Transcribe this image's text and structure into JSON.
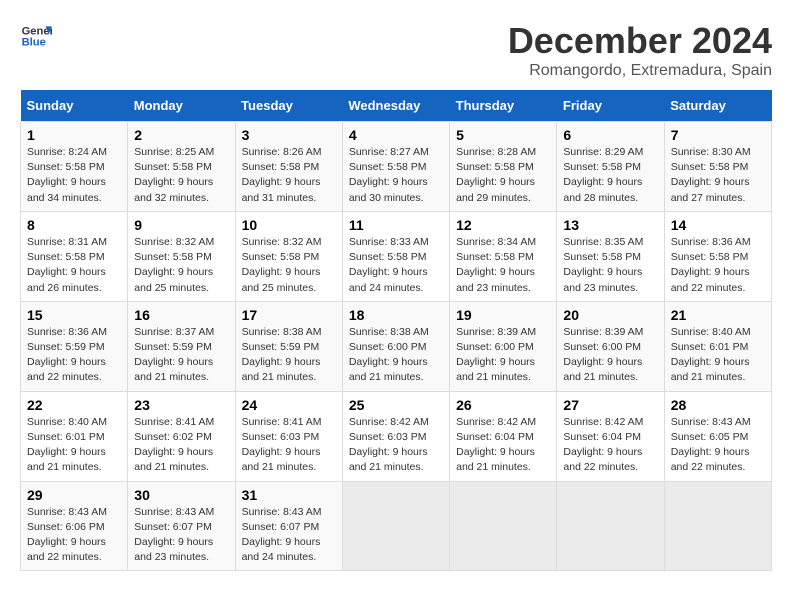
{
  "logo": {
    "line1": "General",
    "line2": "Blue"
  },
  "title": "December 2024",
  "subtitle": "Romangordo, Extremadura, Spain",
  "days_header": [
    "Sunday",
    "Monday",
    "Tuesday",
    "Wednesday",
    "Thursday",
    "Friday",
    "Saturday"
  ],
  "weeks": [
    [
      {
        "num": "1",
        "sunrise": "8:24 AM",
        "sunset": "5:58 PM",
        "daylight": "9 hours and 34 minutes."
      },
      {
        "num": "2",
        "sunrise": "8:25 AM",
        "sunset": "5:58 PM",
        "daylight": "9 hours and 32 minutes."
      },
      {
        "num": "3",
        "sunrise": "8:26 AM",
        "sunset": "5:58 PM",
        "daylight": "9 hours and 31 minutes."
      },
      {
        "num": "4",
        "sunrise": "8:27 AM",
        "sunset": "5:58 PM",
        "daylight": "9 hours and 30 minutes."
      },
      {
        "num": "5",
        "sunrise": "8:28 AM",
        "sunset": "5:58 PM",
        "daylight": "9 hours and 29 minutes."
      },
      {
        "num": "6",
        "sunrise": "8:29 AM",
        "sunset": "5:58 PM",
        "daylight": "9 hours and 28 minutes."
      },
      {
        "num": "7",
        "sunrise": "8:30 AM",
        "sunset": "5:58 PM",
        "daylight": "9 hours and 27 minutes."
      }
    ],
    [
      {
        "num": "8",
        "sunrise": "8:31 AM",
        "sunset": "5:58 PM",
        "daylight": "9 hours and 26 minutes."
      },
      {
        "num": "9",
        "sunrise": "8:32 AM",
        "sunset": "5:58 PM",
        "daylight": "9 hours and 25 minutes."
      },
      {
        "num": "10",
        "sunrise": "8:32 AM",
        "sunset": "5:58 PM",
        "daylight": "9 hours and 25 minutes."
      },
      {
        "num": "11",
        "sunrise": "8:33 AM",
        "sunset": "5:58 PM",
        "daylight": "9 hours and 24 minutes."
      },
      {
        "num": "12",
        "sunrise": "8:34 AM",
        "sunset": "5:58 PM",
        "daylight": "9 hours and 23 minutes."
      },
      {
        "num": "13",
        "sunrise": "8:35 AM",
        "sunset": "5:58 PM",
        "daylight": "9 hours and 23 minutes."
      },
      {
        "num": "14",
        "sunrise": "8:36 AM",
        "sunset": "5:58 PM",
        "daylight": "9 hours and 22 minutes."
      }
    ],
    [
      {
        "num": "15",
        "sunrise": "8:36 AM",
        "sunset": "5:59 PM",
        "daylight": "9 hours and 22 minutes."
      },
      {
        "num": "16",
        "sunrise": "8:37 AM",
        "sunset": "5:59 PM",
        "daylight": "9 hours and 21 minutes."
      },
      {
        "num": "17",
        "sunrise": "8:38 AM",
        "sunset": "5:59 PM",
        "daylight": "9 hours and 21 minutes."
      },
      {
        "num": "18",
        "sunrise": "8:38 AM",
        "sunset": "6:00 PM",
        "daylight": "9 hours and 21 minutes."
      },
      {
        "num": "19",
        "sunrise": "8:39 AM",
        "sunset": "6:00 PM",
        "daylight": "9 hours and 21 minutes."
      },
      {
        "num": "20",
        "sunrise": "8:39 AM",
        "sunset": "6:00 PM",
        "daylight": "9 hours and 21 minutes."
      },
      {
        "num": "21",
        "sunrise": "8:40 AM",
        "sunset": "6:01 PM",
        "daylight": "9 hours and 21 minutes."
      }
    ],
    [
      {
        "num": "22",
        "sunrise": "8:40 AM",
        "sunset": "6:01 PM",
        "daylight": "9 hours and 21 minutes."
      },
      {
        "num": "23",
        "sunrise": "8:41 AM",
        "sunset": "6:02 PM",
        "daylight": "9 hours and 21 minutes."
      },
      {
        "num": "24",
        "sunrise": "8:41 AM",
        "sunset": "6:03 PM",
        "daylight": "9 hours and 21 minutes."
      },
      {
        "num": "25",
        "sunrise": "8:42 AM",
        "sunset": "6:03 PM",
        "daylight": "9 hours and 21 minutes."
      },
      {
        "num": "26",
        "sunrise": "8:42 AM",
        "sunset": "6:04 PM",
        "daylight": "9 hours and 21 minutes."
      },
      {
        "num": "27",
        "sunrise": "8:42 AM",
        "sunset": "6:04 PM",
        "daylight": "9 hours and 22 minutes."
      },
      {
        "num": "28",
        "sunrise": "8:43 AM",
        "sunset": "6:05 PM",
        "daylight": "9 hours and 22 minutes."
      }
    ],
    [
      {
        "num": "29",
        "sunrise": "8:43 AM",
        "sunset": "6:06 PM",
        "daylight": "9 hours and 22 minutes."
      },
      {
        "num": "30",
        "sunrise": "8:43 AM",
        "sunset": "6:07 PM",
        "daylight": "9 hours and 23 minutes."
      },
      {
        "num": "31",
        "sunrise": "8:43 AM",
        "sunset": "6:07 PM",
        "daylight": "9 hours and 24 minutes."
      },
      null,
      null,
      null,
      null
    ]
  ],
  "labels": {
    "sunrise": "Sunrise:",
    "sunset": "Sunset:",
    "daylight": "Daylight:"
  }
}
